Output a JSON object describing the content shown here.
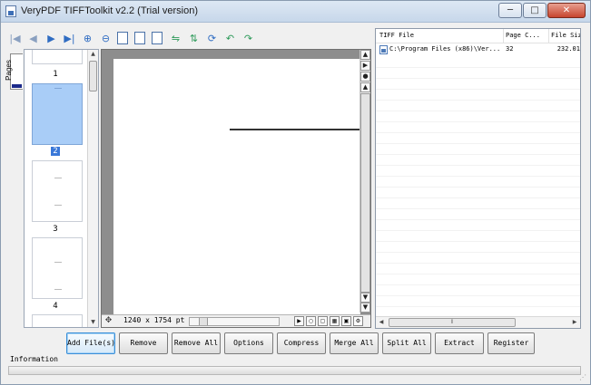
{
  "window": {
    "title": "VeryPDF TIFFToolkit v2.2 (Trial version)",
    "controls": {
      "minimize": "─",
      "maximize": "□",
      "close": "✕"
    }
  },
  "toolbar": {
    "icons": [
      {
        "name": "first-page-icon",
        "glyph": "|◀"
      },
      {
        "name": "prev-page-icon",
        "glyph": "◀"
      },
      {
        "name": "next-page-icon",
        "glyph": "▶"
      },
      {
        "name": "last-page-icon",
        "glyph": "▶|"
      },
      {
        "name": "zoom-in-icon",
        "glyph": "⊕"
      },
      {
        "name": "zoom-out-icon",
        "glyph": "⊖"
      },
      {
        "name": "actual-size-icon",
        "glyph": ""
      },
      {
        "name": "fit-page-icon",
        "glyph": ""
      },
      {
        "name": "fit-width-icon",
        "glyph": ""
      },
      {
        "name": "flip-horizontal-icon",
        "glyph": "⇋"
      },
      {
        "name": "flip-vertical-icon",
        "glyph": "⇅"
      },
      {
        "name": "rotate-icon",
        "glyph": "⟳"
      },
      {
        "name": "rotate-left-icon",
        "glyph": "↶"
      },
      {
        "name": "rotate-right-icon",
        "glyph": "↷"
      }
    ]
  },
  "pages_panel": {
    "tab_label": "Pages",
    "thumbnails": [
      {
        "number": "1",
        "selected": false
      },
      {
        "number": "2",
        "selected": true
      },
      {
        "number": "3",
        "selected": false
      },
      {
        "number": "4",
        "selected": false
      }
    ]
  },
  "viewer": {
    "size_label": "1240 x 1754 pt"
  },
  "file_list": {
    "columns": [
      "TIFF File",
      "Page C...",
      "File Siz"
    ],
    "rows": [
      {
        "file": "C:\\Program Files (x86)\\Ver...",
        "pages": "32",
        "size": "232.01"
      }
    ]
  },
  "buttons": {
    "add_files": "Add File(s)",
    "remove": "Remove",
    "remove_all": "Remove All",
    "options": "Options",
    "compress": "Compress",
    "merge_all": "Merge All",
    "split_all": "Split All",
    "extract": "Extract",
    "register": "Register"
  },
  "info": {
    "label": "Information"
  },
  "colors": {
    "selection": "#a9cdf7",
    "viewer_background": "#8d8d8d",
    "close_button": "#c7442e"
  }
}
